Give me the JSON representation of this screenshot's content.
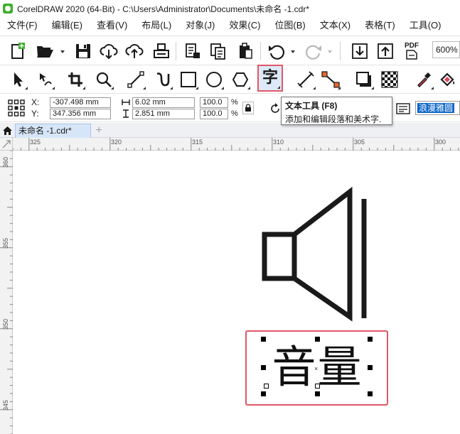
{
  "window": {
    "title": "CorelDRAW 2020 (64-Bit) - C:\\Users\\Administrator\\Documents\\未命名 -1.cdr*"
  },
  "menu": [
    {
      "label": "文件(F)"
    },
    {
      "label": "编辑(E)"
    },
    {
      "label": "查看(V)"
    },
    {
      "label": "布局(L)"
    },
    {
      "label": "对象(J)"
    },
    {
      "label": "效果(C)"
    },
    {
      "label": "位图(B)"
    },
    {
      "label": "文本(X)"
    },
    {
      "label": "表格(T)"
    },
    {
      "label": "工具(O)"
    }
  ],
  "standard_toolbar": {
    "pdf_label": "PDF",
    "zoom": "600%"
  },
  "toolbox": {
    "text_tool_glyph": "字",
    "active_tool": "text-tool"
  },
  "property_bar": {
    "x_label": "X:",
    "y_label": "Y:",
    "x_value": "-307.498 mm",
    "y_value": "347.356 mm",
    "width_value": "6.02 mm",
    "height_value": "2.851 mm",
    "scale_w": "100.0",
    "scale_h": "100.0",
    "percent": "%",
    "font_name": "浪漫雅圆"
  },
  "tooltip": {
    "title": "文本工具 (F8)",
    "description": "添加和编辑段落和美术字."
  },
  "document_tabs": [
    {
      "label": "未命名 -1.cdr*"
    }
  ],
  "tab_add_glyph": "+",
  "ruler": {
    "h_labels": [
      "325",
      "320",
      "315",
      "310",
      "305",
      "300"
    ],
    "v_labels": [
      "360",
      "355",
      "350",
      "345"
    ]
  },
  "canvas": {
    "art_text": "音量",
    "center_mark": "×"
  },
  "colors": {
    "accent_highlight": "#e05766",
    "selection_blue": "#0a64c8",
    "tab_active": "#d6e6f8",
    "speaker_stroke": "#1a1a1a"
  }
}
